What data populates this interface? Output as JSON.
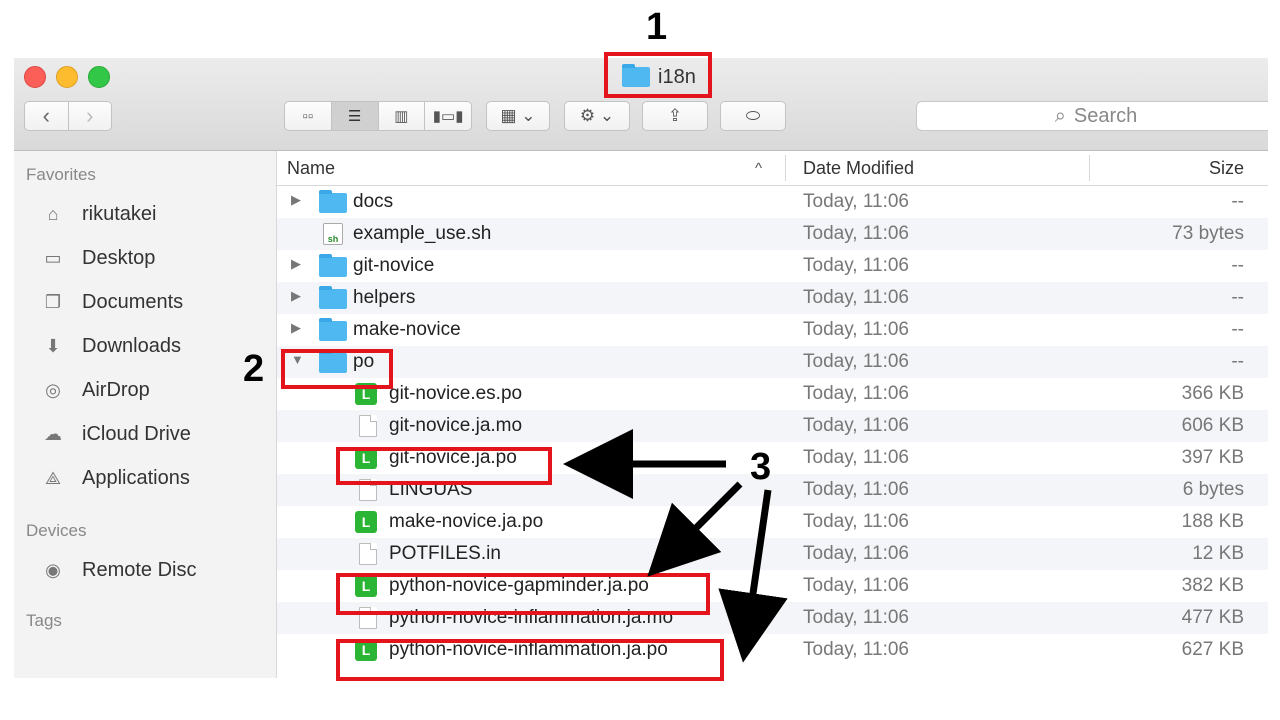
{
  "window": {
    "title": "i18n"
  },
  "toolbar": {
    "back_icon": "chevron-left-icon",
    "forward_icon": "chevron-right-icon",
    "search_placeholder": "Search"
  },
  "sidebar": {
    "favorites_heading": "Favorites",
    "favorites": [
      {
        "label": "rikutakei",
        "icon": "home-icon"
      },
      {
        "label": "Desktop",
        "icon": "desktop-icon"
      },
      {
        "label": "Documents",
        "icon": "documents-icon"
      },
      {
        "label": "Downloads",
        "icon": "downloads-icon"
      },
      {
        "label": "AirDrop",
        "icon": "airdrop-icon"
      },
      {
        "label": "iCloud Drive",
        "icon": "cloud-icon"
      },
      {
        "label": "Applications",
        "icon": "applications-icon"
      }
    ],
    "devices_heading": "Devices",
    "devices": [
      {
        "label": "Remote Disc",
        "icon": "disc-icon"
      }
    ],
    "tags_heading": "Tags"
  },
  "columns": {
    "name": "Name",
    "date": "Date Modified",
    "size": "Size",
    "sort_indicator": "^"
  },
  "files": [
    {
      "name": "docs",
      "date": "Today, 11:06",
      "size": "--"
    },
    {
      "name": "example_use.sh",
      "date": "Today, 11:06",
      "size": "73 bytes"
    },
    {
      "name": "git-novice",
      "date": "Today, 11:06",
      "size": "--"
    },
    {
      "name": "helpers",
      "date": "Today, 11:06",
      "size": "--"
    },
    {
      "name": "make-novice",
      "date": "Today, 11:06",
      "size": "--"
    },
    {
      "name": "po",
      "date": "Today, 11:06",
      "size": "--"
    },
    {
      "name": "git-novice.es.po",
      "date": "Today, 11:06",
      "size": "366 KB"
    },
    {
      "name": "git-novice.ja.mo",
      "date": "Today, 11:06",
      "size": "606 KB"
    },
    {
      "name": "git-novice.ja.po",
      "date": "Today, 11:06",
      "size": "397 KB"
    },
    {
      "name": "LINGUAS",
      "date": "Today, 11:06",
      "size": "6 bytes"
    },
    {
      "name": "make-novice.ja.po",
      "date": "Today, 11:06",
      "size": "188 KB"
    },
    {
      "name": "POTFILES.in",
      "date": "Today, 11:06",
      "size": "12 KB"
    },
    {
      "name": "python-novice-gapminder.ja.po",
      "date": "Today, 11:06",
      "size": "382 KB"
    },
    {
      "name": "python-novice-inflammation.ja.mo",
      "date": "Today, 11:06",
      "size": "477 KB"
    },
    {
      "name": "python-novice-inflammation.ja.po",
      "date": "Today, 11:06",
      "size": "627 KB"
    }
  ],
  "annotations": {
    "one": "1",
    "two": "2",
    "three": "3"
  },
  "colors": {
    "highlight": "#e3141b",
    "folder": "#4fb8f0",
    "po_icon": "#2bb534"
  }
}
